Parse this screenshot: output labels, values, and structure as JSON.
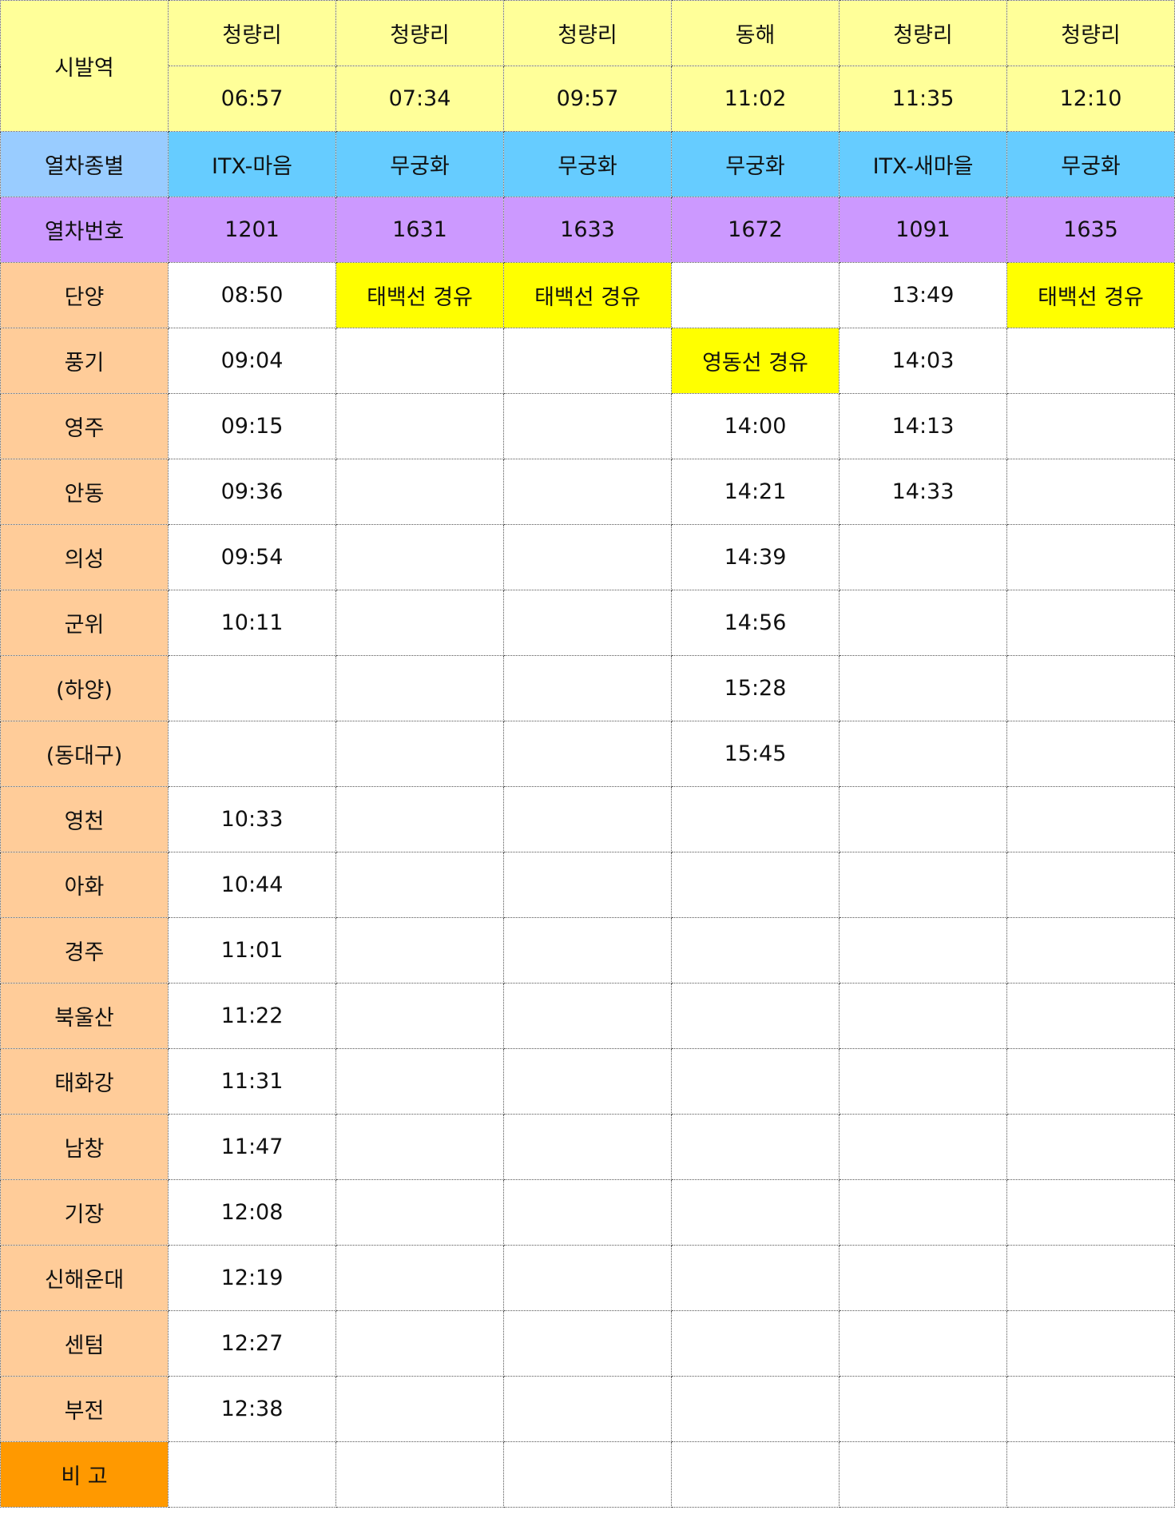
{
  "colors": {
    "origin_header_bg": "#ffff99",
    "type_label_bg": "#99ccff",
    "type_row_bg": "#66ccff",
    "number_row_bg": "#cc99ff",
    "station_label_bg": "#ffcc99",
    "remarks_label_bg": "#ff9900",
    "via_highlight_bg": "#ffff00"
  },
  "headers": {
    "origin_label": "시발역",
    "type_label": "열차종별",
    "number_label": "열차번호",
    "remarks_label": "비 고"
  },
  "trains": [
    {
      "origin": "청량리",
      "departure": "06:57",
      "type": "ITX-마음",
      "number": "1201"
    },
    {
      "origin": "청량리",
      "departure": "07:34",
      "type": "무궁화",
      "number": "1631"
    },
    {
      "origin": "청량리",
      "departure": "09:57",
      "type": "무궁화",
      "number": "1633"
    },
    {
      "origin": "동해",
      "departure": "11:02",
      "type": "무궁화",
      "number": "1672"
    },
    {
      "origin": "청량리",
      "departure": "11:35",
      "type": "ITX-새마을",
      "number": "1091"
    },
    {
      "origin": "청량리",
      "departure": "12:10",
      "type": "무궁화",
      "number": "1635"
    }
  ],
  "stations": [
    {
      "name": "단양",
      "cells": [
        "08:50",
        "태백선 경유",
        "태백선 경유",
        "",
        "13:49",
        "태백선 경유"
      ],
      "highlight": [
        false,
        true,
        true,
        false,
        false,
        true
      ]
    },
    {
      "name": "풍기",
      "cells": [
        "09:04",
        "",
        "",
        "영동선 경유",
        "14:03",
        ""
      ],
      "highlight": [
        false,
        false,
        false,
        true,
        false,
        false
      ]
    },
    {
      "name": "영주",
      "cells": [
        "09:15",
        "",
        "",
        "14:00",
        "14:13",
        ""
      ],
      "highlight": [
        false,
        false,
        false,
        false,
        false,
        false
      ]
    },
    {
      "name": "안동",
      "cells": [
        "09:36",
        "",
        "",
        "14:21",
        "14:33",
        ""
      ],
      "highlight": [
        false,
        false,
        false,
        false,
        false,
        false
      ]
    },
    {
      "name": "의성",
      "cells": [
        "09:54",
        "",
        "",
        "14:39",
        "",
        ""
      ],
      "highlight": [
        false,
        false,
        false,
        false,
        false,
        false
      ]
    },
    {
      "name": "군위",
      "cells": [
        "10:11",
        "",
        "",
        "14:56",
        "",
        ""
      ],
      "highlight": [
        false,
        false,
        false,
        false,
        false,
        false
      ]
    },
    {
      "name": "(하양)",
      "cells": [
        "",
        "",
        "",
        "15:28",
        "",
        ""
      ],
      "highlight": [
        false,
        false,
        false,
        false,
        false,
        false
      ]
    },
    {
      "name": "(동대구)",
      "cells": [
        "",
        "",
        "",
        "15:45",
        "",
        ""
      ],
      "highlight": [
        false,
        false,
        false,
        false,
        false,
        false
      ]
    },
    {
      "name": "영천",
      "cells": [
        "10:33",
        "",
        "",
        "",
        "",
        ""
      ],
      "highlight": [
        false,
        false,
        false,
        false,
        false,
        false
      ]
    },
    {
      "name": "아화",
      "cells": [
        "10:44",
        "",
        "",
        "",
        "",
        ""
      ],
      "highlight": [
        false,
        false,
        false,
        false,
        false,
        false
      ]
    },
    {
      "name": "경주",
      "cells": [
        "11:01",
        "",
        "",
        "",
        "",
        ""
      ],
      "highlight": [
        false,
        false,
        false,
        false,
        false,
        false
      ]
    },
    {
      "name": "북울산",
      "cells": [
        "11:22",
        "",
        "",
        "",
        "",
        ""
      ],
      "highlight": [
        false,
        false,
        false,
        false,
        false,
        false
      ]
    },
    {
      "name": "태화강",
      "cells": [
        "11:31",
        "",
        "",
        "",
        "",
        ""
      ],
      "highlight": [
        false,
        false,
        false,
        false,
        false,
        false
      ]
    },
    {
      "name": "남창",
      "cells": [
        "11:47",
        "",
        "",
        "",
        "",
        ""
      ],
      "highlight": [
        false,
        false,
        false,
        false,
        false,
        false
      ]
    },
    {
      "name": "기장",
      "cells": [
        "12:08",
        "",
        "",
        "",
        "",
        ""
      ],
      "highlight": [
        false,
        false,
        false,
        false,
        false,
        false
      ]
    },
    {
      "name": "신해운대",
      "cells": [
        "12:19",
        "",
        "",
        "",
        "",
        ""
      ],
      "highlight": [
        false,
        false,
        false,
        false,
        false,
        false
      ]
    },
    {
      "name": "센텀",
      "cells": [
        "12:27",
        "",
        "",
        "",
        "",
        ""
      ],
      "highlight": [
        false,
        false,
        false,
        false,
        false,
        false
      ]
    },
    {
      "name": "부전",
      "cells": [
        "12:38",
        "",
        "",
        "",
        "",
        ""
      ],
      "highlight": [
        false,
        false,
        false,
        false,
        false,
        false
      ]
    }
  ],
  "remarks": [
    "",
    "",
    "",
    "",
    "",
    ""
  ]
}
